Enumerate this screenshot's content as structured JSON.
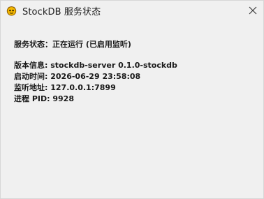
{
  "window": {
    "title": "StockDB 服务状态",
    "app_icon": "app-emblem-icon",
    "close_icon": "close-icon"
  },
  "status": {
    "label": "服务状态：",
    "value": "正在运行 (已启用监听)"
  },
  "info": [
    {
      "label": "版本信息:",
      "value": "stockdb-server 0.1.0-stockdb"
    },
    {
      "label": "启动时间:",
      "value": "2026-06-29 23:58:08"
    },
    {
      "label": "监听地址:",
      "value": "127.0.0.1:7899"
    },
    {
      "label": "进程 PID:",
      "value": "9928"
    }
  ],
  "colors": {
    "background": "#f0f0f0",
    "text": "#1a1a1a",
    "icon_fill": "#f5b800"
  }
}
